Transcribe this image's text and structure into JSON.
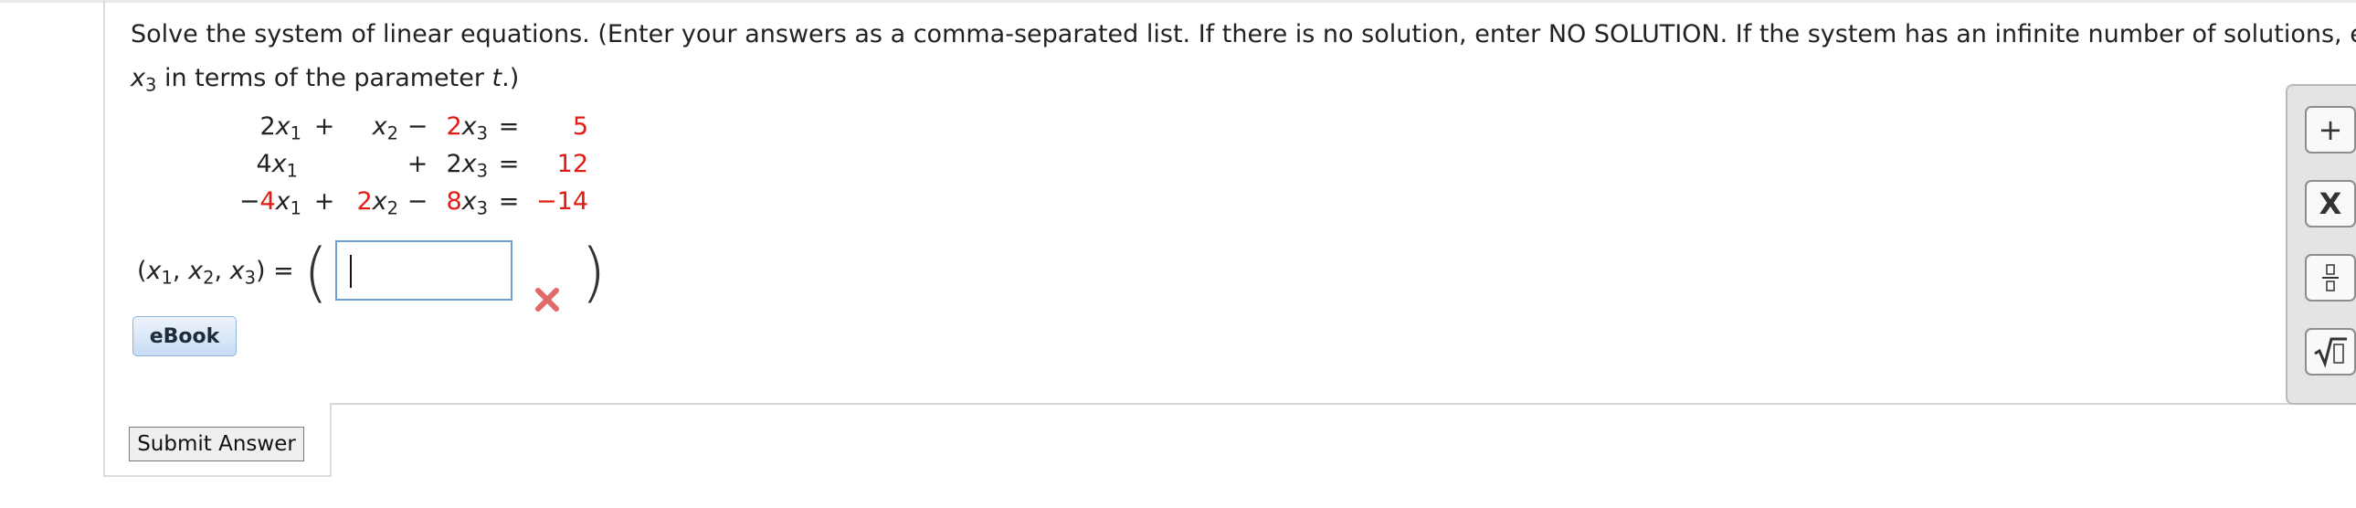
{
  "question": {
    "line1": "Solve the system of linear equations. (Enter your answers as a comma-separated list. If there is no solution, enter NO SOLUTION. If the system has an infinite number of solutions, expr",
    "line2_var": "x",
    "line2_sub": "3",
    "line2_mid": " in terms of the parameter ",
    "line2_param": "t",
    "line2_end": ".)"
  },
  "equations": [
    {
      "lead": "",
      "c1": "2",
      "v1": "x",
      "s1": "1",
      "op1": "+",
      "c2": "",
      "v2": "x",
      "s2": "2",
      "op2": "−",
      "c3": "2",
      "v3": "x",
      "s3": "3",
      "eq": "=",
      "rhs": "5"
    },
    {
      "lead": "",
      "c1": "4",
      "v1": "x",
      "s1": "1",
      "op1": "",
      "c2": "",
      "v2": "",
      "s2": "",
      "op2": "+",
      "c3": "2",
      "v3": "x",
      "s3": "3",
      "eq": "=",
      "rhs": "12"
    },
    {
      "lead": "−",
      "c1": "4",
      "v1": "x",
      "s1": "1",
      "op1": "+",
      "c2": "2",
      "v2": "x",
      "s2": "2",
      "op2": "−",
      "c3": "8",
      "v3": "x",
      "s3": "3",
      "eq": "=",
      "rhs": "−14"
    }
  ],
  "answer": {
    "label_open": "(",
    "var": "x",
    "sub1": "1",
    "sub2": "2",
    "sub3": "3",
    "sep": ", ",
    "label_close": ") =",
    "input_value": "",
    "status_icon": "wrong-x-icon"
  },
  "buttons": {
    "ebook": "eBook",
    "submit": "Submit Answer"
  },
  "toolbar": {
    "plus": "+",
    "times": "X",
    "fraction_icon": "fraction-icon",
    "sqrt_icon": "sqrt-icon"
  },
  "colors": {
    "highlight_red": "#e21b13",
    "input_border": "#6e9cd0",
    "ebook_bg": "#c8dcf4"
  }
}
